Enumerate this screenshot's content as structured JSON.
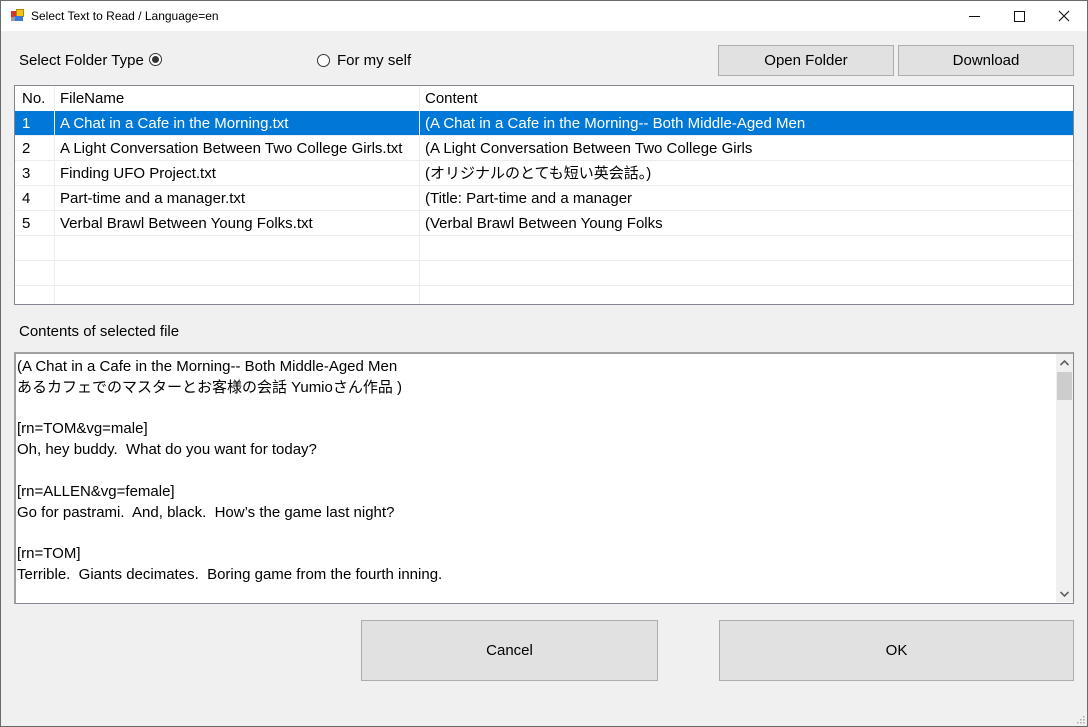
{
  "window": {
    "title": "Select Text to Read / Language=en",
    "controls": {
      "minimize": "minimize",
      "maximize": "maximize",
      "close": "close"
    }
  },
  "folder_type": {
    "label": "Select Folder Type",
    "option_default_checked": true,
    "option_self_label": "For my self",
    "option_self_checked": false
  },
  "toolbar": {
    "open_folder_label": "Open Folder",
    "download_label": "Download"
  },
  "grid": {
    "columns": [
      "No.",
      "FileName",
      "Content"
    ],
    "selected_index": 0,
    "rows": [
      {
        "no": "1",
        "filename": "A Chat in a Cafe in the Morning.txt",
        "content": "(A Chat in a Cafe in the Morning-- Both Middle-Aged Men"
      },
      {
        "no": "2",
        "filename": "A Light Conversation Between Two College Girls.txt",
        "content": "(A Light Conversation Between Two College Girls"
      },
      {
        "no": "3",
        "filename": "Finding UFO Project.txt",
        "content": "(オリジナルのとても短い英会話。)"
      },
      {
        "no": "4",
        "filename": "Part-time and a manager.txt",
        "content": "(Title: Part-time and a manager"
      },
      {
        "no": "5",
        "filename": "Verbal Brawl Between Young Folks.txt",
        "content": "(Verbal Brawl Between Young Folks"
      }
    ]
  },
  "contents": {
    "label": "Contents of selected file",
    "lines": [
      "(A Chat in a Cafe in the Morning-- Both Middle-Aged Men",
      "あるカフェでのマスターとお客様の会話 Yumioさん作品 )",
      "",
      "[rn=TOM&vg=male]",
      "Oh, hey buddy.  What do you want for today?",
      "",
      "[rn=ALLEN&vg=female]",
      "Go for pastrami.  And, black.  How’s the game last night?",
      "",
      "[rn=TOM]",
      "Terrible.  Giants decimates.  Boring game from the fourth inning."
    ]
  },
  "footer": {
    "cancel_label": "Cancel",
    "ok_label": "OK"
  },
  "colors": {
    "selection": "#0078d7",
    "window_bg": "#f0f0f0",
    "button_bg": "#e1e1e1"
  }
}
